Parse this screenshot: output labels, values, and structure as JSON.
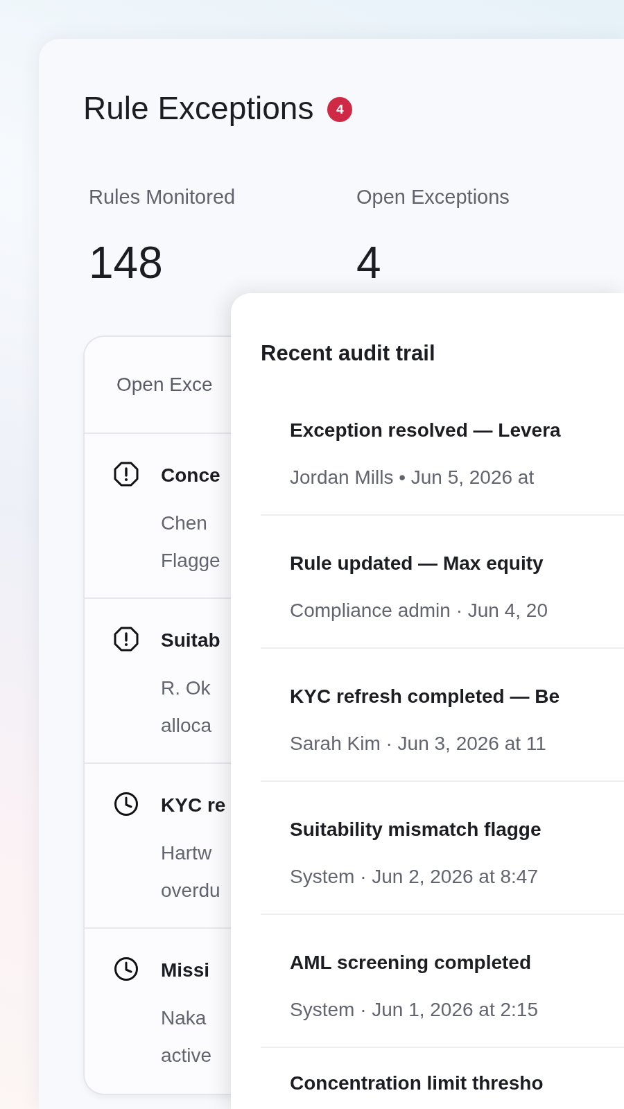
{
  "header": {
    "title": "Rule Exceptions",
    "badge": "4"
  },
  "stats": [
    {
      "label": "Rules Monitored",
      "value": "148"
    },
    {
      "label": "Open Exceptions",
      "value": "4"
    }
  ],
  "exceptions_list": {
    "heading": "Open Exce",
    "items": [
      {
        "kind": "alert",
        "title": "Conce",
        "lines": [
          "Chen",
          "Flagge"
        ]
      },
      {
        "kind": "alert",
        "title": "Suitab",
        "lines": [
          "R. Ok",
          "alloca"
        ]
      },
      {
        "kind": "pending",
        "title": "KYC re",
        "lines": [
          "Hartw",
          "overdu"
        ]
      },
      {
        "kind": "pending",
        "title": "Missi",
        "lines": [
          "Naka",
          "active"
        ]
      }
    ]
  },
  "audit_panel": {
    "title": "Recent audit trail",
    "entries": [
      {
        "title": "Exception resolved — Levera",
        "meta": "Jordan Mills • Jun 5, 2026 at"
      },
      {
        "title": "Rule updated — Max equity",
        "meta": "Compliance admin · Jun 4, 20"
      },
      {
        "title": "KYC refresh completed — Be",
        "meta": "Sarah Kim · Jun 3, 2026 at 11"
      },
      {
        "title": "Suitability mismatch flagge",
        "meta": "System · Jun 2, 2026 at 8:47"
      },
      {
        "title": "AML screening completed",
        "meta": "System · Jun 1, 2026 at 2:15"
      },
      {
        "title": "Concentration limit thresho"
      }
    ]
  }
}
